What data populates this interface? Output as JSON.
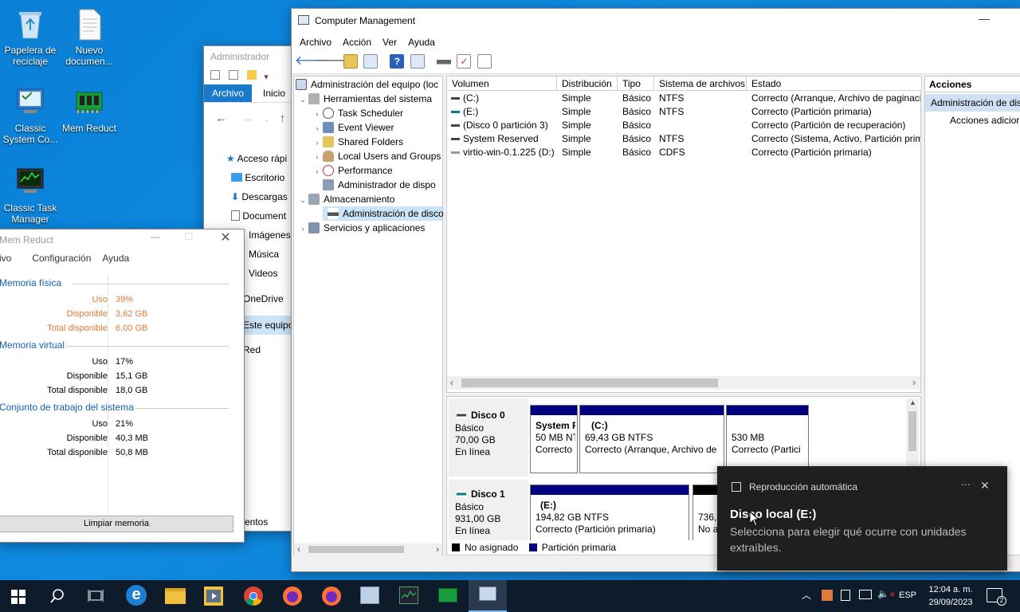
{
  "desktop": {
    "icons": [
      {
        "label1": "Papelera de",
        "label2": "reciclaje",
        "icon": "recycle-bin-icon"
      },
      {
        "label1": "Nuevo",
        "label2": "documen...",
        "icon": "text-document-icon"
      },
      {
        "label1": "Classic",
        "label2": "System Co...",
        "icon": "control-panel-icon"
      },
      {
        "label1": "Mem Reduct",
        "label2": "",
        "icon": "memory-chip-icon"
      },
      {
        "label1": "Classic Task",
        "label2": "Manager",
        "icon": "task-manager-icon"
      }
    ]
  },
  "explorer": {
    "title": "Administrador",
    "tabs": [
      "Archivo",
      "Inicio"
    ],
    "nav": [
      "Acceso rápi",
      "Escritorio",
      "Descargas",
      "Document",
      "Imágenes",
      "Música",
      "Videos",
      "OneDrive",
      "Este equipo",
      "Red"
    ],
    "status": "entos"
  },
  "memreduct": {
    "title": "Mem Reduct",
    "menu": [
      "ivo",
      "Configuración",
      "Ayuda"
    ],
    "sections": [
      {
        "name": "Memoria física",
        "rows": [
          [
            "Uso",
            "39%"
          ],
          [
            "Disponible",
            "3,62 GB"
          ],
          [
            "Total disponible",
            "6,00 GB"
          ]
        ]
      },
      {
        "name": "Memoria virtual",
        "rows": [
          [
            "Uso",
            "17%"
          ],
          [
            "Disponible",
            "15,1 GB"
          ],
          [
            "Total disponible",
            "18,0 GB"
          ]
        ]
      },
      {
        "name": "Conjunto de trabajo del sistema",
        "rows": [
          [
            "Uso",
            "21%"
          ],
          [
            "Disponible",
            "40,3 MB"
          ],
          [
            "Total disponible",
            "50,8 MB"
          ]
        ]
      }
    ],
    "clean_button": "Limpiar memoria",
    "highlight_color": "#e07a3a"
  },
  "cm": {
    "title": "Computer Management",
    "menu": [
      "Archivo",
      "Acción",
      "Ver",
      "Ayuda"
    ],
    "tree": [
      {
        "label": "Administración del equipo (loc",
        "level": 0,
        "arrow": "",
        "icon": "computer-icon"
      },
      {
        "label": "Herramientas del sistema",
        "level": 1,
        "arrow": "⌄",
        "icon": "tools-icon"
      },
      {
        "label": "Task Scheduler",
        "level": 2,
        "arrow": "›",
        "icon": "clock-icon"
      },
      {
        "label": "Event Viewer",
        "level": 2,
        "arrow": "›",
        "icon": "event-viewer-icon"
      },
      {
        "label": "Shared Folders",
        "level": 2,
        "arrow": "›",
        "icon": "shared-folder-icon"
      },
      {
        "label": "Local Users and Groups",
        "level": 2,
        "arrow": "›",
        "icon": "users-icon"
      },
      {
        "label": "Performance",
        "level": 2,
        "arrow": "›",
        "icon": "performance-icon"
      },
      {
        "label": "Administrador de dispo",
        "level": 2,
        "arrow": "",
        "icon": "device-manager-icon"
      },
      {
        "label": "Almacenamiento",
        "level": 1,
        "arrow": "⌄",
        "icon": "storage-icon"
      },
      {
        "label": "Administración de disco",
        "level": 2,
        "arrow": "",
        "icon": "disk-management-icon",
        "selected": true
      },
      {
        "label": "Servicios y aplicaciones",
        "level": 1,
        "arrow": "›",
        "icon": "services-icon"
      }
    ],
    "columns": [
      "Volumen",
      "Distribución",
      "Tipo",
      "Sistema de archivos",
      "Estado"
    ],
    "volumes": [
      [
        "(C:)",
        "Simple",
        "Básico",
        "NTFS",
        "Correcto (Arranque, Archivo de paginaci"
      ],
      [
        "(E:)",
        "Simple",
        "Básico",
        "NTFS",
        "Correcto (Partición primaria)"
      ],
      [
        "(Disco 0 partición 3)",
        "Simple",
        "Básico",
        "",
        "Correcto (Partición de recuperación)"
      ],
      [
        "System Reserved",
        "Simple",
        "Básico",
        "NTFS",
        "Correcto (Sistema, Activo, Partición prim"
      ],
      [
        "virtio-win-0.1.225 (D:)",
        "Simple",
        "Básico",
        "CDFS",
        "Correcto (Partición primaria)"
      ]
    ],
    "disks": [
      {
        "name": "Disco 0",
        "type": "Básico",
        "size": "70,00 GB",
        "status": "En línea",
        "parts": [
          {
            "title": "System F",
            "size": "50 MB NT",
            "state": "Correcto"
          },
          {
            "title": "(C:)",
            "size": "69,43 GB NTFS",
            "state": "Correcto (Arranque, Archivo de"
          },
          {
            "title": "",
            "size": "530 MB",
            "state": "Correcto (Partici"
          }
        ]
      },
      {
        "name": "Disco 1",
        "type": "Básico",
        "size": "931,00 GB",
        "status": "En línea",
        "parts": [
          {
            "title": "(E:)",
            "size": "194,82 GB NTFS",
            "state": "Correcto (Partición primaria)"
          },
          {
            "title": "",
            "size": "736,",
            "state": "No a"
          }
        ]
      }
    ],
    "legend": [
      "No asignado",
      "Partición primaria"
    ],
    "actions_header": "Acciones",
    "actions_item": "Administración de dis",
    "actions_more": "Acciones adicior",
    "primary_color": "#000080"
  },
  "toast": {
    "app": "Reproducción automática",
    "title": "Disco local (E:)",
    "body1": "Selecciona para elegir qué ocurre con unidades",
    "body2": "extraíbles."
  },
  "taskbar": {
    "lang": "ESP",
    "time": "12:04 a. m.",
    "date": "29/09/2023",
    "notif_count": "2"
  }
}
